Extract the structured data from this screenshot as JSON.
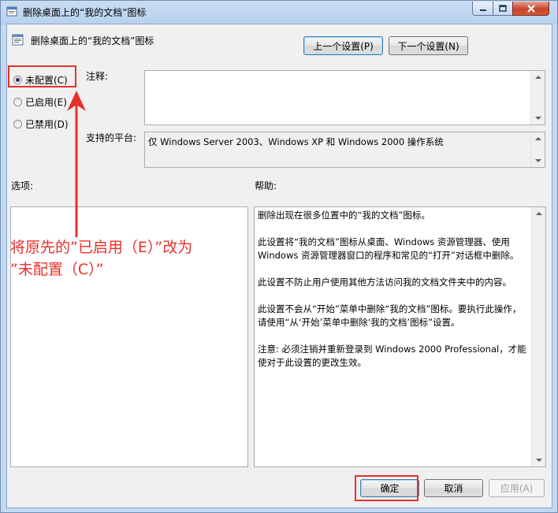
{
  "window": {
    "title": "删除桌面上的“我的文档”图标"
  },
  "header": {
    "policy_title": "删除桌面上的“我的文档”图标",
    "prev_button": "上一个设置(P)",
    "next_button": "下一个设置(N)"
  },
  "options": {
    "not_configured": "未配置(C)",
    "enabled": "已启用(E)",
    "disabled": "已禁用(D)",
    "selected": "not_configured"
  },
  "labels": {
    "comment": "注释:",
    "supported_on": "支持的平台:",
    "options": "选项:",
    "help": "帮助:"
  },
  "fields": {
    "comment_value": "",
    "supported_value": "仅 Windows Server 2003、Windows XP 和 Windows 2000 操作系统"
  },
  "help_paragraphs": [
    "删除出现在很多位置中的“我的文档”图标。",
    "此设置将“我的文档”图标从桌面、Windows 资源管理器、使用 Windows 资源管理器窗口的程序和常见的“打开”对话框中删除。",
    "此设置不防止用户使用其他方法访问我的文档文件夹中的内容。",
    "此设置不会从“开始”菜单中删除“我的文档”图标。要执行此操作，请使用“从‘开始’菜单中删除‘我的文档’图标”设置。",
    "注意: 必须注销并重新登录到 Windows 2000 Professional，才能使对于此设置的更改生效。"
  ],
  "footer": {
    "ok": "确定",
    "cancel": "取消",
    "apply": "应用(A)"
  },
  "annotation": {
    "line1": "将原先的”已启用（E）”改为",
    "line2": "”未配置（C）”",
    "color": "#e8302a"
  }
}
